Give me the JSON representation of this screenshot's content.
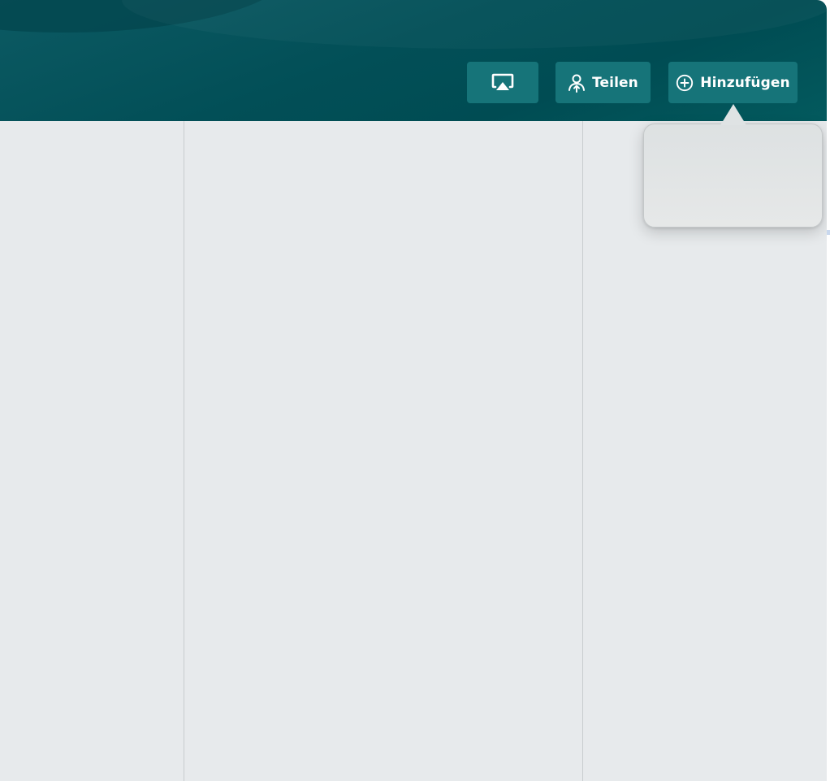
{
  "toolbar": {
    "airplay": {
      "icon": "airplay-icon"
    },
    "share": {
      "label": "Teilen",
      "icon": "person-share-icon"
    },
    "add": {
      "label": "Hinzufügen",
      "icon": "plus-circle-icon"
    }
  },
  "colors": {
    "header_bg": "#024f57",
    "button_bg": "#167479",
    "content_bg": "#e7eaec",
    "divider": "#c8ccce",
    "popover_bg": "#e2e5e6"
  },
  "popover": {
    "visible": true
  },
  "columns": {
    "count": 3
  }
}
